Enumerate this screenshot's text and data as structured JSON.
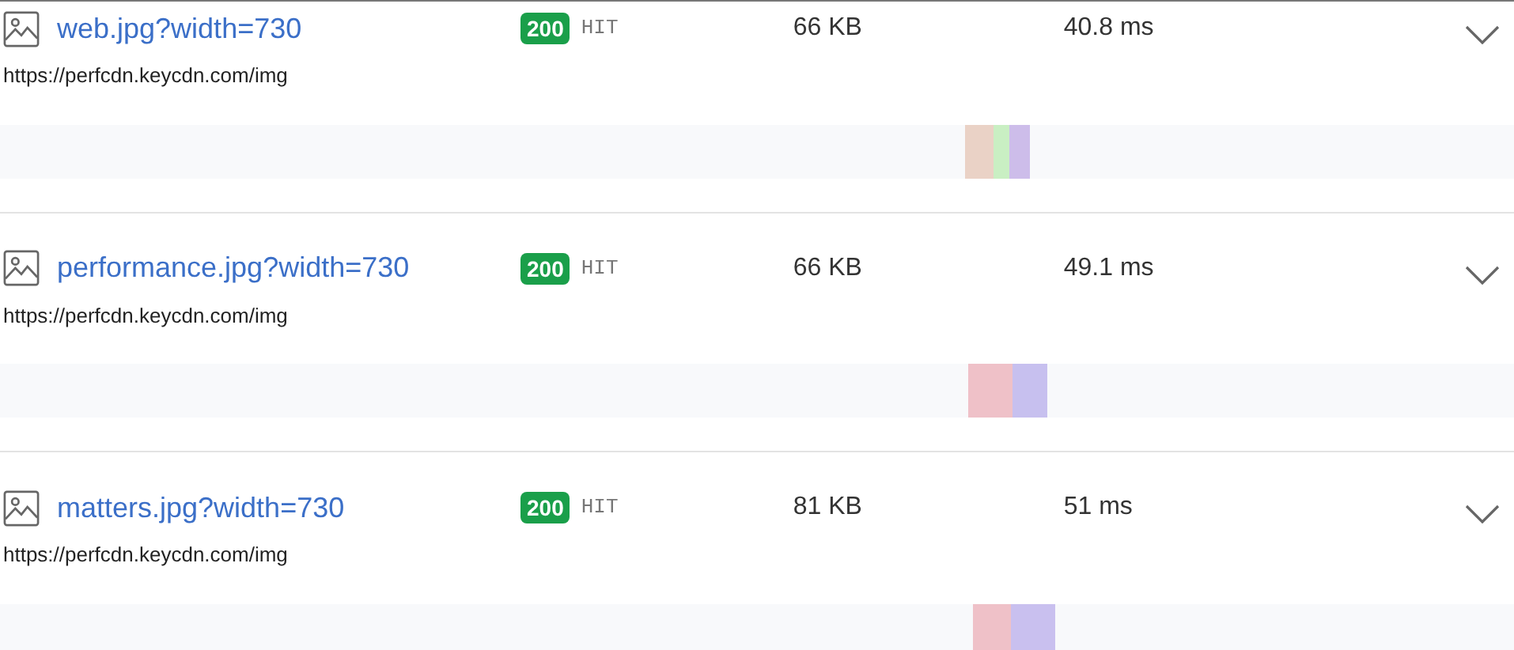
{
  "requests": [
    {
      "name": "web.jpg?width=730",
      "status": "200",
      "cache": "HIT",
      "size": "66 KB",
      "time": "40.8 ms",
      "url": "https://perfcdn.keycdn.com/img",
      "segments": [
        {
          "color": "#ead2c6"
        },
        {
          "color": "#c9efc3"
        },
        {
          "color": "#cdbdea"
        }
      ]
    },
    {
      "name": "performance.jpg?width=730",
      "status": "200",
      "cache": "HIT",
      "size": "66 KB",
      "time": "49.1 ms",
      "url": "https://perfcdn.keycdn.com/img",
      "segments": [
        {
          "color": "#efc1c8"
        },
        {
          "color": "#c7c0ef"
        }
      ]
    },
    {
      "name": "matters.jpg?width=730",
      "status": "200",
      "cache": "HIT",
      "size": "81 KB",
      "time": "51 ms",
      "url": "https://perfcdn.keycdn.com/img",
      "segments": [
        {
          "color": "#efc1c8"
        },
        {
          "color": "#c9c0ef"
        }
      ]
    }
  ]
}
